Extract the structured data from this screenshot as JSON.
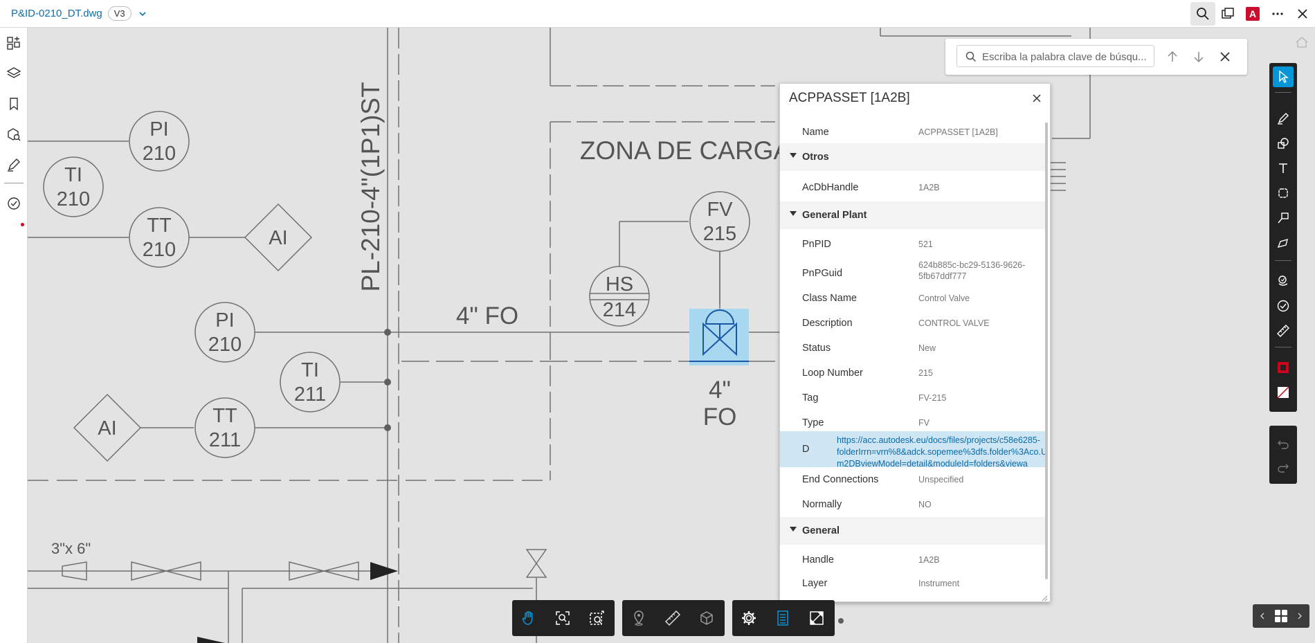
{
  "topbar": {
    "file_name": "P&ID-0210_DT.dwg",
    "version": "V3"
  },
  "drawing": {
    "instruments": [
      {
        "id": "PI-210-a",
        "tag": "PI",
        "num": "210"
      },
      {
        "id": "TI-210",
        "tag": "TI",
        "num": "210"
      },
      {
        "id": "TT-210",
        "tag": "TT",
        "num": "210"
      },
      {
        "id": "AI-a",
        "tag": "AI"
      },
      {
        "id": "PI-210-b",
        "tag": "PI",
        "num": "210"
      },
      {
        "id": "TI-211",
        "tag": "TI",
        "num": "211"
      },
      {
        "id": "AI-b",
        "tag": "AI"
      },
      {
        "id": "TT-211",
        "tag": "TT",
        "num": "211"
      },
      {
        "id": "FV-215",
        "tag": "FV",
        "num": "215"
      },
      {
        "id": "HS-214",
        "tag": "HS",
        "num": "214"
      }
    ],
    "zone_label": "ZONA DE CARGA",
    "pipe_label_vertical": "PL-210-4\"(1P1)ST",
    "line_label_1": "4\" FO",
    "line_label_2_a": "4\"",
    "line_label_2_b": "FO",
    "reducer_label": "3\"x 6\""
  },
  "search": {
    "placeholder": "Escriba la palabra clave de búsqu..."
  },
  "properties": {
    "title": "ACPPASSET [1A2B]",
    "name_row": {
      "key": "Name",
      "value": "ACPPASSET [1A2B]"
    },
    "section_otros": "Otros",
    "acdb": {
      "key": "AcDbHandle",
      "value": "1A2B"
    },
    "section_general_plant": "General Plant",
    "rows": [
      {
        "key": "PnPID",
        "value": "521"
      },
      {
        "key": "PnPGuid",
        "value": "624b885c-bc29-5136-9626-",
        "value2": "5fb67ddf777"
      },
      {
        "key": "Class Name",
        "value": "Control Valve"
      },
      {
        "key": "Description",
        "value": "CONTROL VALVE"
      },
      {
        "key": "Status",
        "value": "New"
      },
      {
        "key": "Loop Number",
        "value": "215"
      },
      {
        "key": "Tag",
        "value": "FV-215"
      },
      {
        "key": "Type",
        "value": "FV"
      }
    ],
    "link_row": {
      "key": "D",
      "line1": "https://acc.autodesk.eu/docs/files/projects/c58e6285-",
      "line2": "folderIrrn=vrn%8&adck.sopemee%3dfs.folder%3Aco.U",
      "line3": "m2DBviewModel=detail&moduleId=folders&viewa"
    },
    "rows2": [
      {
        "key": "End Connections",
        "value": "Unspecified"
      },
      {
        "key": "Normally",
        "value": "NO"
      }
    ],
    "section_general": "General",
    "rows3": [
      {
        "key": "Handle",
        "value": "1A2B"
      },
      {
        "key": "Layer",
        "value": "Instrument"
      }
    ]
  },
  "colors": {
    "accent": "#0696d7",
    "selection": "#a8d8f0",
    "drawing_line": "#707070",
    "toolbar_bg": "#222222"
  }
}
